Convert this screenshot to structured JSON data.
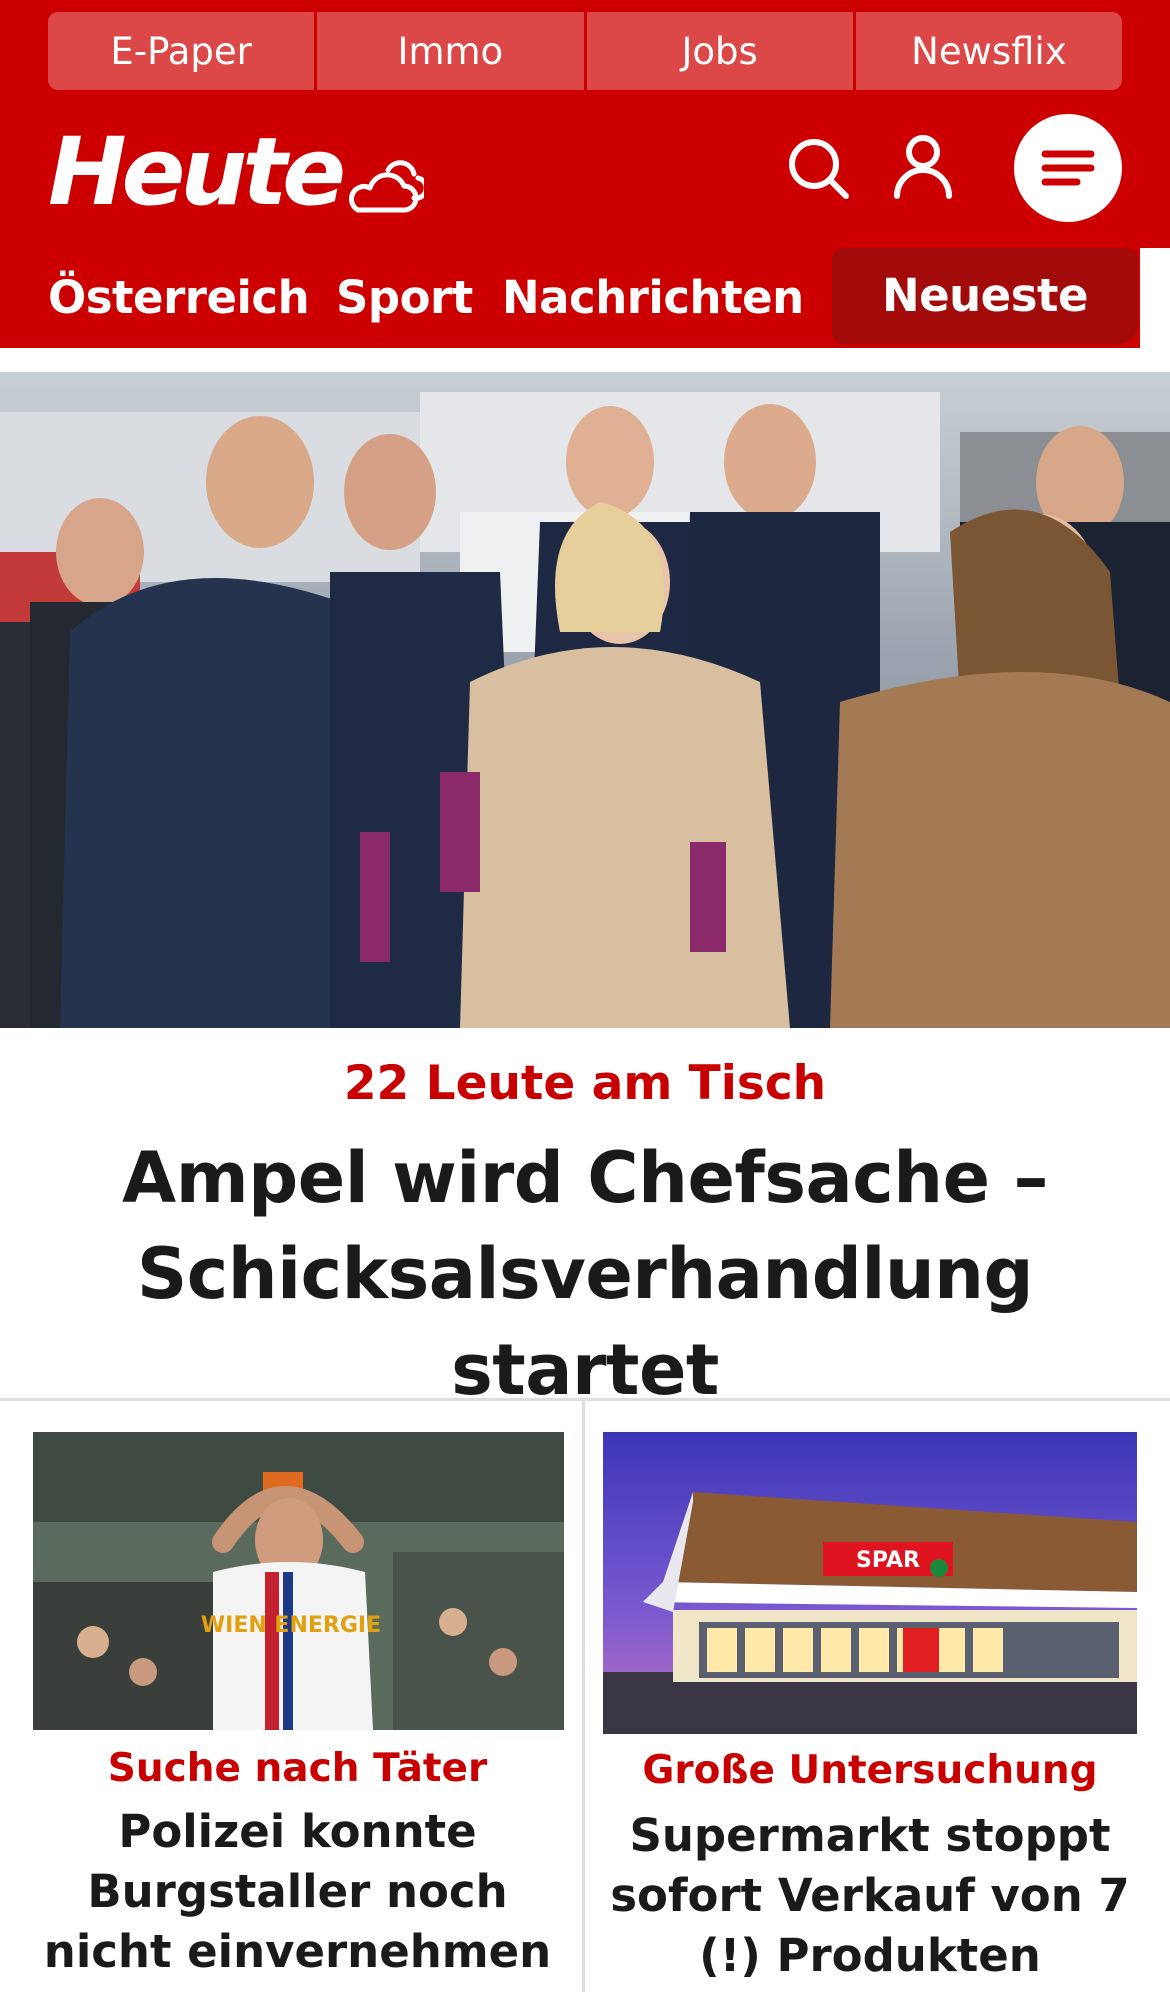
{
  "topbar": {
    "items": [
      "E-Paper",
      "Immo",
      "Jobs",
      "Newsflix"
    ]
  },
  "brand": {
    "logo_text": "Heute",
    "primary_color": "#cc0000"
  },
  "icons": {
    "weather": "cloud-sun-icon",
    "search": "search-icon",
    "user": "user-icon",
    "menu": "menu-icon"
  },
  "nav": {
    "items": [
      "Österreich",
      "Sport",
      "Nachrichten"
    ],
    "active_label": "Neueste"
  },
  "hero": {
    "kicker": "22 Leute am Tisch",
    "title": "Ampel wird Chefsache – Schicksalsverhandlung startet"
  },
  "cards": [
    {
      "kicker": "Suche nach Täter",
      "title": "Polizei konnte Burgstaller noch nicht einvernehmen",
      "jersey_text": "WIEN ENERGIE"
    },
    {
      "kicker": "Große Untersuchung",
      "title": "Supermarkt stoppt sofort Verkauf von 7 (!) Produkten",
      "store_sign": "SPAR"
    }
  ]
}
